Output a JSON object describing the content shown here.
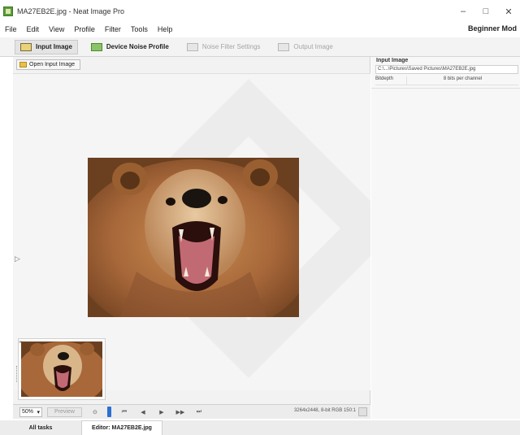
{
  "window": {
    "title": "MA27EB2E.jpg - Neat Image Pro",
    "minimize": "–",
    "maximize": "□",
    "close": "✕"
  },
  "menu": {
    "items": [
      "File",
      "Edit",
      "View",
      "Profile",
      "Filter",
      "Tools",
      "Help"
    ],
    "mode": "Beginner Mod"
  },
  "steps": [
    {
      "label": "Input Image",
      "icon": "photo-icon",
      "state": "active"
    },
    {
      "label": "Device Noise Profile",
      "icon": "profile-icon",
      "state": "enabled"
    },
    {
      "label": "Noise Filter Settings",
      "icon": "filter-icon",
      "state": "disabled"
    },
    {
      "label": "Output Image",
      "icon": "output-icon",
      "state": "disabled"
    }
  ],
  "main": {
    "open_button": "Open Input Image",
    "image_subject": "bear",
    "thumb_close": "×"
  },
  "bottom": {
    "zoom": "50%",
    "preview_button": "Preview",
    "nav": [
      "⊙",
      "⏮",
      "◀",
      "▶",
      "▶▶",
      "⏭"
    ],
    "status": "3264x2448, 8-bit RGB 150:1"
  },
  "info_panel": {
    "title": "Input Image",
    "path": "C:\\...\\Pictures\\Saved Pictures\\MA27EB2E.jpg",
    "bitdepth_key": "Bitdepth",
    "bitdepth_val": "8 bits per channel"
  },
  "doc_tabs": {
    "all": "All tasks",
    "editor": "Editor: MA27EB2E.jpg"
  },
  "colors": {
    "accent": "#2a6fd1",
    "app_icon": "#5a9b3c"
  }
}
